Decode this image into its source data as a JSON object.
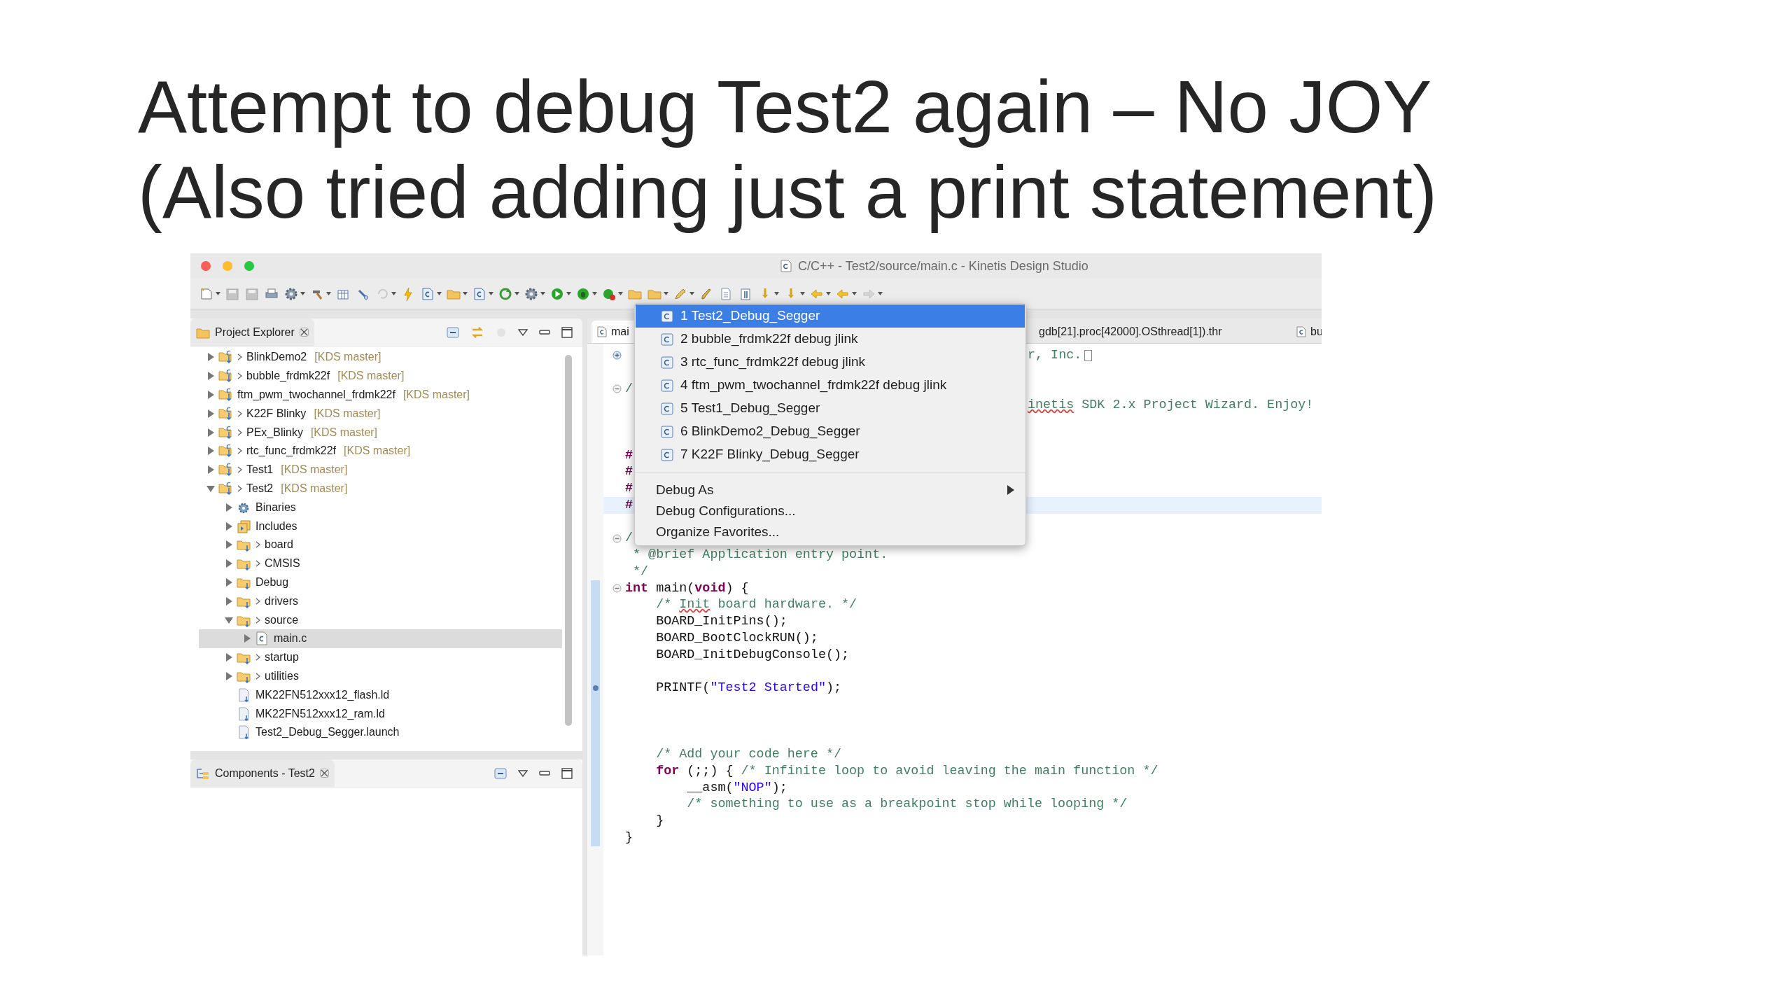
{
  "slide": {
    "title_lines": [
      "Attempt to debug Test2 again – No JOY",
      "(Also tried adding just a print statement)"
    ]
  },
  "window": {
    "title": "C/C++ - Test2/source/main.c - Kinetis Design Studio"
  },
  "project_explorer": {
    "title": "Project Explorer",
    "tree": [
      {
        "label": "BlinkDemo2",
        "tag": "[KDS master]",
        "kind": "project",
        "dirty": true,
        "expanded": false,
        "selected": false
      },
      {
        "label": "bubble_frdmk22f",
        "tag": "[KDS master]",
        "kind": "project",
        "dirty": true,
        "expanded": false,
        "selected": false
      },
      {
        "label": "ftm_pwm_twochannel_frdmk22f",
        "tag": "[KDS master]",
        "kind": "project",
        "dirty": false,
        "expanded": false,
        "selected": false
      },
      {
        "label": "K22F Blinky",
        "tag": "[KDS master]",
        "kind": "project",
        "dirty": true,
        "expanded": false,
        "selected": false
      },
      {
        "label": "PEx_Blinky",
        "tag": "[KDS master]",
        "kind": "project",
        "dirty": true,
        "expanded": false,
        "selected": false
      },
      {
        "label": "rtc_func_frdmk22f",
        "tag": "[KDS master]",
        "kind": "project",
        "dirty": true,
        "expanded": false,
        "selected": false
      },
      {
        "label": "Test1",
        "tag": "[KDS master]",
        "kind": "project",
        "dirty": true,
        "expanded": false,
        "selected": false
      },
      {
        "label": "Test2",
        "tag": "[KDS master]",
        "kind": "project",
        "dirty": true,
        "expanded": true,
        "selected": false,
        "children": [
          {
            "label": "Binaries",
            "kind": "binaries",
            "dirty": false,
            "expanded": false,
            "selected": false
          },
          {
            "label": "Includes",
            "kind": "includes",
            "dirty": false,
            "expanded": false,
            "selected": false
          },
          {
            "label": "board",
            "kind": "folder",
            "dirty": true,
            "expanded": false,
            "selected": false
          },
          {
            "label": "CMSIS",
            "kind": "folder",
            "dirty": true,
            "expanded": false,
            "selected": false
          },
          {
            "label": "Debug",
            "kind": "folder",
            "dirty": false,
            "expanded": false,
            "selected": false
          },
          {
            "label": "drivers",
            "kind": "folder",
            "dirty": true,
            "expanded": false,
            "selected": false
          },
          {
            "label": "source",
            "kind": "folder",
            "dirty": true,
            "expanded": true,
            "selected": false,
            "children": [
              {
                "label": "main.c",
                "kind": "source",
                "dirty": false,
                "expanded": false,
                "selected": true
              }
            ]
          },
          {
            "label": "startup",
            "kind": "folder",
            "dirty": true,
            "expanded": false,
            "selected": false
          },
          {
            "label": "utilities",
            "kind": "folder",
            "dirty": true,
            "expanded": false,
            "selected": false
          },
          {
            "label": "MK22FN512xxx12_flash.ld",
            "kind": "file",
            "dirty": false,
            "selected": false
          },
          {
            "label": "MK22FN512xxx12_ram.ld",
            "kind": "file",
            "dirty": false,
            "selected": false
          },
          {
            "label": "Test2_Debug_Segger.launch",
            "kind": "file",
            "dirty": false,
            "selected": false
          }
        ]
      }
    ]
  },
  "components": {
    "title": "Components - Test2"
  },
  "editor": {
    "tabs": [
      {
        "label": "mai",
        "selected": true
      },
      {
        "label": "gdb[21].proc[42000].OSthread[1]).thr",
        "selected": false
      },
      {
        "label": "bu",
        "selected": false
      }
    ],
    "lines": [
      {
        "kind": "tail",
        "folded": true,
        "current": false,
        "segments": [
          {
            "text": "r, Inc.",
            "kind": "comment"
          }
        ]
      },
      {
        "current": false
      },
      {
        "kind": "code",
        "folded": false,
        "current": false,
        "segments": [
          {
            "text": "/",
            "kind": "comment"
          }
        ]
      },
      {
        "kind": "tail",
        "current": false,
        "segments": [
          {
            "text": "inetis",
            "kind": "misspelled"
          },
          {
            "text": " SDK 2.x Project Wizard. Enjoy!",
            "kind": "comment"
          }
        ]
      },
      {
        "current": false
      },
      {
        "current": false
      },
      {
        "kind": "code",
        "current": false,
        "segments": [
          {
            "text": "#",
            "kind": "preproc"
          }
        ]
      },
      {
        "kind": "code",
        "current": false,
        "segments": [
          {
            "text": "#",
            "kind": "preproc"
          }
        ]
      },
      {
        "kind": "code",
        "current": false,
        "segments": [
          {
            "text": "#",
            "kind": "preproc"
          }
        ]
      },
      {
        "kind": "code",
        "current": true,
        "segments": [
          {
            "text": "#",
            "kind": "preproc"
          }
        ]
      },
      {
        "current": false
      },
      {
        "kind": "code",
        "folded": false,
        "current": false,
        "segments": [
          {
            "text": "/",
            "kind": "comment"
          }
        ]
      },
      {
        "kind": "code",
        "current": false,
        "segments": [
          {
            "text": " * @brief Application entry point.",
            "kind": "comment"
          }
        ]
      },
      {
        "kind": "code",
        "current": false,
        "segments": [
          {
            "text": " */",
            "kind": "comment"
          }
        ]
      },
      {
        "kind": "code",
        "folded": false,
        "current": false,
        "range": true,
        "segments": [
          {
            "text": "int",
            "kind": "keyword"
          },
          {
            "text": " main(",
            "kind": "plain"
          },
          {
            "text": "void",
            "kind": "keyword"
          },
          {
            "text": ") {",
            "kind": "plain"
          }
        ]
      },
      {
        "kind": "code",
        "current": false,
        "range": true,
        "segments": [
          {
            "text": "    /* ",
            "kind": "comment"
          },
          {
            "text": "Init",
            "kind": "misspelled"
          },
          {
            "text": " board hardware. */",
            "kind": "comment"
          }
        ]
      },
      {
        "kind": "code",
        "current": false,
        "range": true,
        "segments": [
          {
            "text": "    BOARD_InitPins();",
            "kind": "plain"
          }
        ]
      },
      {
        "kind": "code",
        "current": false,
        "range": true,
        "segments": [
          {
            "text": "    BOARD_BootClockRUN();",
            "kind": "plain"
          }
        ]
      },
      {
        "kind": "code",
        "current": false,
        "range": true,
        "segments": [
          {
            "text": "    BOARD_InitDebugConsole();",
            "kind": "plain"
          }
        ]
      },
      {
        "current": false,
        "range": true
      },
      {
        "kind": "code",
        "current": false,
        "range": true,
        "marker": true,
        "segments": [
          {
            "text": "    PRINTF(",
            "kind": "plain"
          },
          {
            "text": "\"Test2 Started\"",
            "kind": "string"
          },
          {
            "text": ");",
            "kind": "plain"
          }
        ]
      },
      {
        "current": false,
        "range": true
      },
      {
        "current": false,
        "range": true
      },
      {
        "current": false,
        "range": true
      },
      {
        "kind": "code",
        "current": false,
        "range": true,
        "segments": [
          {
            "text": "    /* Add your code here */",
            "kind": "comment"
          }
        ]
      },
      {
        "kind": "code",
        "current": false,
        "range": true,
        "segments": [
          {
            "text": "    for",
            "kind": "keyword"
          },
          {
            "text": " (;;) { ",
            "kind": "plain"
          },
          {
            "text": "/* Infinite loop to avoid leaving the main function */",
            "kind": "comment"
          }
        ]
      },
      {
        "kind": "code",
        "current": false,
        "range": true,
        "segments": [
          {
            "text": "        __asm(",
            "kind": "plain"
          },
          {
            "text": "\"NOP\"",
            "kind": "string"
          },
          {
            "text": ");",
            "kind": "plain"
          }
        ]
      },
      {
        "kind": "code",
        "current": false,
        "range": true,
        "segments": [
          {
            "text": "        /* something to use as a breakpoint stop while looping */",
            "kind": "comment"
          }
        ]
      },
      {
        "kind": "code",
        "current": false,
        "range": true,
        "segments": [
          {
            "text": "    }",
            "kind": "plain"
          }
        ]
      },
      {
        "kind": "code",
        "current": false,
        "range": true,
        "segments": [
          {
            "text": "}",
            "kind": "plain"
          }
        ]
      }
    ]
  },
  "debug_menu": {
    "favorites": [
      {
        "label": "1 Test2_Debug_Segger",
        "selected": true
      },
      {
        "label": "2 bubble_frdmk22f debug jlink",
        "selected": false
      },
      {
        "label": "3 rtc_func_frdmk22f debug jlink",
        "selected": false
      },
      {
        "label": "4 ftm_pwm_twochannel_frdmk22f debug jlink",
        "selected": false
      },
      {
        "label": "5 Test1_Debug_Segger",
        "selected": false
      },
      {
        "label": "6 BlinkDemo2_Debug_Segger",
        "selected": false
      },
      {
        "label": "7 K22F Blinky_Debug_Segger",
        "selected": false
      }
    ],
    "actions": [
      {
        "label": "Debug As",
        "submenu": true
      },
      {
        "label": "Debug Configurations...",
        "submenu": false
      },
      {
        "label": "Organize Favorites...",
        "submenu": false
      }
    ]
  }
}
